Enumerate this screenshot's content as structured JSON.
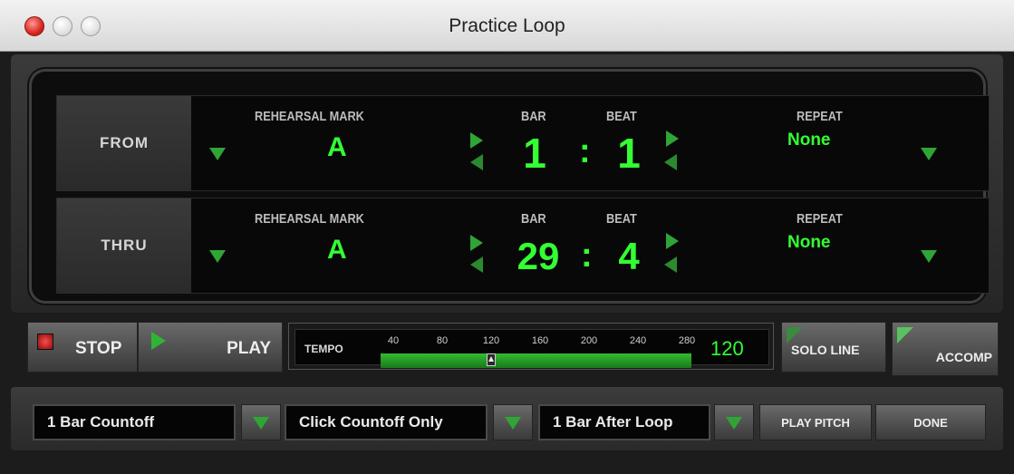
{
  "window": {
    "title": "Practice Loop"
  },
  "from": {
    "label": "FROM",
    "rehearsal_mark_label": "REHEARSAL MARK",
    "rehearsal_mark": "A",
    "bar_label": "BAR",
    "beat_label": "BEAT",
    "bar": "1",
    "separator": ":",
    "beat": "1",
    "repeat_label": "REPEAT",
    "repeat": "None"
  },
  "thru": {
    "label": "THRU",
    "rehearsal_mark_label": "REHEARSAL MARK",
    "rehearsal_mark": "A",
    "bar_label": "BAR",
    "beat_label": "BEAT",
    "bar": "29",
    "separator": ":",
    "beat": "4",
    "repeat_label": "REPEAT",
    "repeat": "None"
  },
  "transport": {
    "stop_label": "STOP",
    "play_label": "PLAY"
  },
  "tempo": {
    "label": "TEMPO",
    "ticks": [
      "40",
      "80",
      "120",
      "160",
      "200",
      "240",
      "280"
    ],
    "value": "120"
  },
  "toggles": {
    "solo_line_label": "SOLO LINE",
    "accomp_label": "ACCOMP"
  },
  "bottom": {
    "countoff": "1 Bar Countoff",
    "click": "Click Countoff Only",
    "after_loop": "1 Bar After Loop",
    "play_pitch_label": "PLAY PITCH",
    "done_label": "DONE"
  },
  "colors": {
    "accent_green": "#33ff33",
    "stop_led": "#d9261c"
  }
}
